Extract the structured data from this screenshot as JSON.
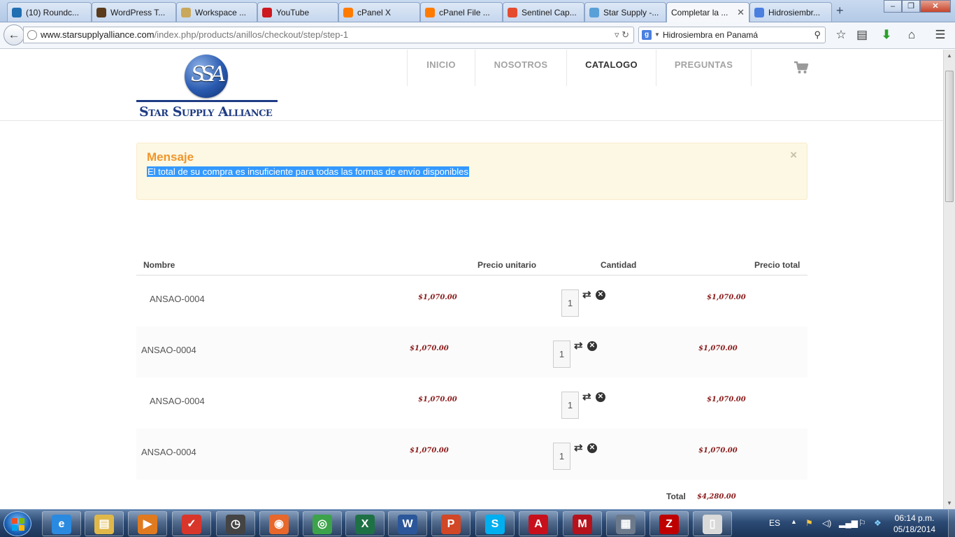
{
  "browser": {
    "tabs": [
      {
        "label": "(10) Roundc...",
        "icon": "roundcube-icon",
        "color": "#1f6fb2"
      },
      {
        "label": "WordPress T...",
        "icon": "wordpress-icon",
        "color": "#5a3b1c"
      },
      {
        "label": "Workspace ...",
        "icon": "workspace-icon",
        "color": "#c9a85c"
      },
      {
        "label": "YouTube",
        "icon": "youtube-icon",
        "color": "#cc181e"
      },
      {
        "label": "cPanel X",
        "icon": "cpanel-icon",
        "color": "#ff7b00"
      },
      {
        "label": "cPanel File ...",
        "icon": "cpanel-icon",
        "color": "#ff7b00"
      },
      {
        "label": "Sentinel Cap...",
        "icon": "joomla-icon",
        "color": "#e44c2f"
      },
      {
        "label": "Star Supply -...",
        "icon": "joomla-icon",
        "color": "#5aa0d8"
      },
      {
        "label": "Completar la ...",
        "icon": "",
        "color": ""
      },
      {
        "label": "Hidrosiembr...",
        "icon": "google-icon",
        "color": "#4a7fe0"
      }
    ],
    "active_tab_index": 8,
    "url_host": "www.starsupplyalliance.com",
    "url_path": "/index.php/products/anillos/checkout/step/step-1",
    "search_engine_letter": "g",
    "search_query": "Hidrosiembra en Panamá"
  },
  "site": {
    "logo_monogram": "SSA",
    "logo_name": "Star Supply Alliance",
    "nav": [
      {
        "label": "INICIO",
        "active": false
      },
      {
        "label": "NOSOTROS",
        "active": false
      },
      {
        "label": "CATALOGO",
        "active": true
      },
      {
        "label": "PREGUNTAS",
        "active": false
      }
    ]
  },
  "alert": {
    "title": "Mensaje",
    "message": "El total de su compra es insuficiente para todas las formas de envío disponibles",
    "close": "×"
  },
  "cart": {
    "headers": {
      "name": "Nombre",
      "unit_price": "Precio unitario",
      "quantity": "Cantidad",
      "total_price": "Precio total"
    },
    "rows": [
      {
        "name": "ANSAO-0004",
        "unit_price": "$1,070.00",
        "quantity": "1",
        "total": "$1,070.00"
      },
      {
        "name": "ANSAO-0004",
        "unit_price": "$1,070.00",
        "quantity": "1",
        "total": "$1,070.00"
      },
      {
        "name": "ANSAO-0004",
        "unit_price": "$1,070.00",
        "quantity": "1",
        "total": "$1,070.00"
      },
      {
        "name": "ANSAO-0004",
        "unit_price": "$1,070.00",
        "quantity": "1",
        "total": "$1,070.00"
      }
    ],
    "total_label": "Total",
    "total_value": "$4,280.00"
  },
  "taskbar": {
    "apps": [
      {
        "name": "internet-explorer-icon",
        "glyph": "e",
        "color": "#2a8ae0"
      },
      {
        "name": "file-explorer-icon",
        "glyph": "▤",
        "color": "#e0b84a"
      },
      {
        "name": "media-player-icon",
        "glyph": "▶",
        "color": "#e07a1f"
      },
      {
        "name": "todoist-icon",
        "glyph": "✓",
        "color": "#d8362b"
      },
      {
        "name": "clock-icon",
        "glyph": "◷",
        "color": "#444"
      },
      {
        "name": "firefox-icon",
        "glyph": "◉",
        "color": "#e8672a"
      },
      {
        "name": "chrome-icon",
        "glyph": "◎",
        "color": "#3ca34a"
      },
      {
        "name": "excel-icon",
        "glyph": "X",
        "color": "#1e7145"
      },
      {
        "name": "word-icon",
        "glyph": "W",
        "color": "#2b579a"
      },
      {
        "name": "powerpoint-icon",
        "glyph": "P",
        "color": "#d24726"
      },
      {
        "name": "skype-icon",
        "glyph": "S",
        "color": "#00aff0"
      },
      {
        "name": "acrobat-icon",
        "glyph": "A",
        "color": "#c8101d"
      },
      {
        "name": "mcafee-icon",
        "glyph": "M",
        "color": "#b5121b"
      },
      {
        "name": "calculator-icon",
        "glyph": "▦",
        "color": "#6c7a8c"
      },
      {
        "name": "filezilla-icon",
        "glyph": "Z",
        "color": "#bf0000"
      },
      {
        "name": "notepad-icon",
        "glyph": "▯",
        "color": "#d9d9d9"
      }
    ],
    "language": "ES",
    "time": "06:14 p.m.",
    "date": "05/18/2014"
  }
}
